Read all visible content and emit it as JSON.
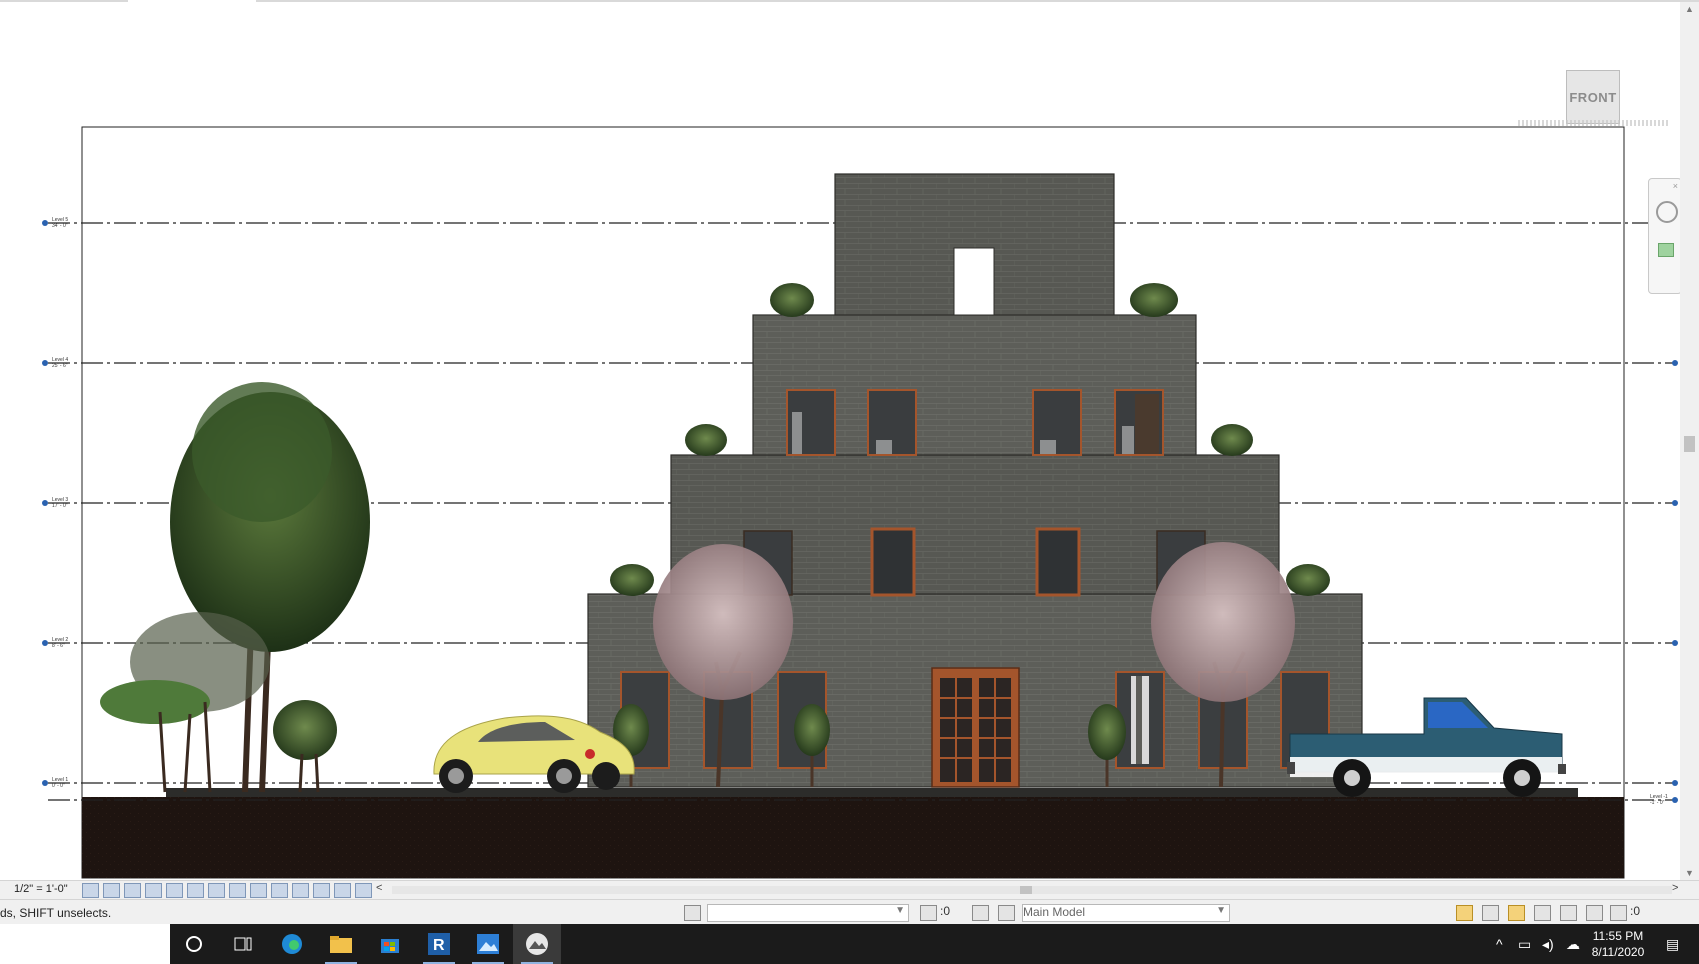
{
  "view": {
    "viewcube_label": "FRONT",
    "levels": [
      {
        "name": "Level 5",
        "elev": "34' - 0\""
      },
      {
        "name": "Level 4",
        "elev": "25' - 6\""
      },
      {
        "name": "Level 3",
        "elev": "17' - 0\""
      },
      {
        "name": "Level 2",
        "elev": "8' - 6\""
      },
      {
        "name": "Level 1",
        "elev": "0' - 0\""
      },
      {
        "name": "Level -1",
        "elev": "-1' - 0\""
      }
    ]
  },
  "view_control_bar": {
    "scale": "1/2\" = 1'-0\"",
    "collapse_arrow": "<",
    "scroll_right_arrow": ">"
  },
  "status_bar": {
    "hint": "ds, SHIFT unselects.",
    "worksets_value": "",
    "editable_count": ":0",
    "design_option": "Main Model",
    "filter_count": ":0"
  },
  "taskbar": {
    "apps": [
      "search-circle",
      "task-view",
      "edge",
      "file-explorer",
      "store",
      "revit",
      "photos",
      "active-app"
    ],
    "time": "11:55 PM",
    "date": "8/11/2020"
  },
  "colors": {
    "masonry": "#5d5e59",
    "ground": "#1e1410",
    "truck": "#2c5d73",
    "car": "#e8e27a",
    "door": "#a4552c"
  }
}
